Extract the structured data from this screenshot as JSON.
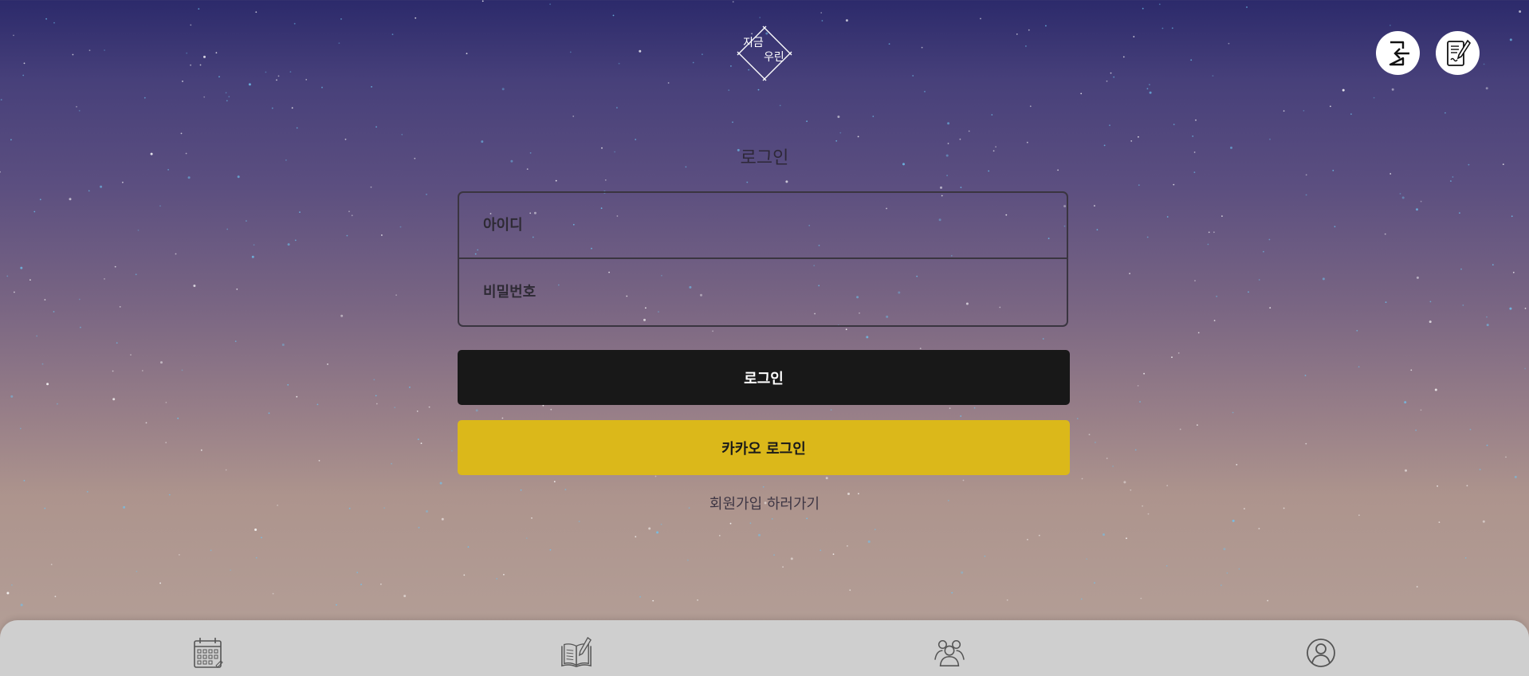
{
  "logo": {
    "text_line1": "지금",
    "text_line2": "우린"
  },
  "header": {
    "icons": [
      {
        "name": "logout-icon",
        "label": ""
      },
      {
        "name": "diary-write-icon",
        "label": ""
      }
    ]
  },
  "login": {
    "title": "로그인",
    "id_placeholder": "아이디",
    "password_placeholder": "비밀번호",
    "login_button": "로그인",
    "kakao_button": "카카오 로그인",
    "signup_link": "회원가입 하러가기"
  },
  "bottom_nav": {
    "items": [
      {
        "name": "calendar-icon"
      },
      {
        "name": "diary-book-icon"
      },
      {
        "name": "community-icon"
      },
      {
        "name": "profile-icon"
      }
    ]
  },
  "colors": {
    "login_button": "#181818",
    "kakao_button": "#dbb81a",
    "nav_background": "#cfcfcf",
    "sky_top": "#2c2a6b",
    "sky_bottom": "#b5a199"
  }
}
